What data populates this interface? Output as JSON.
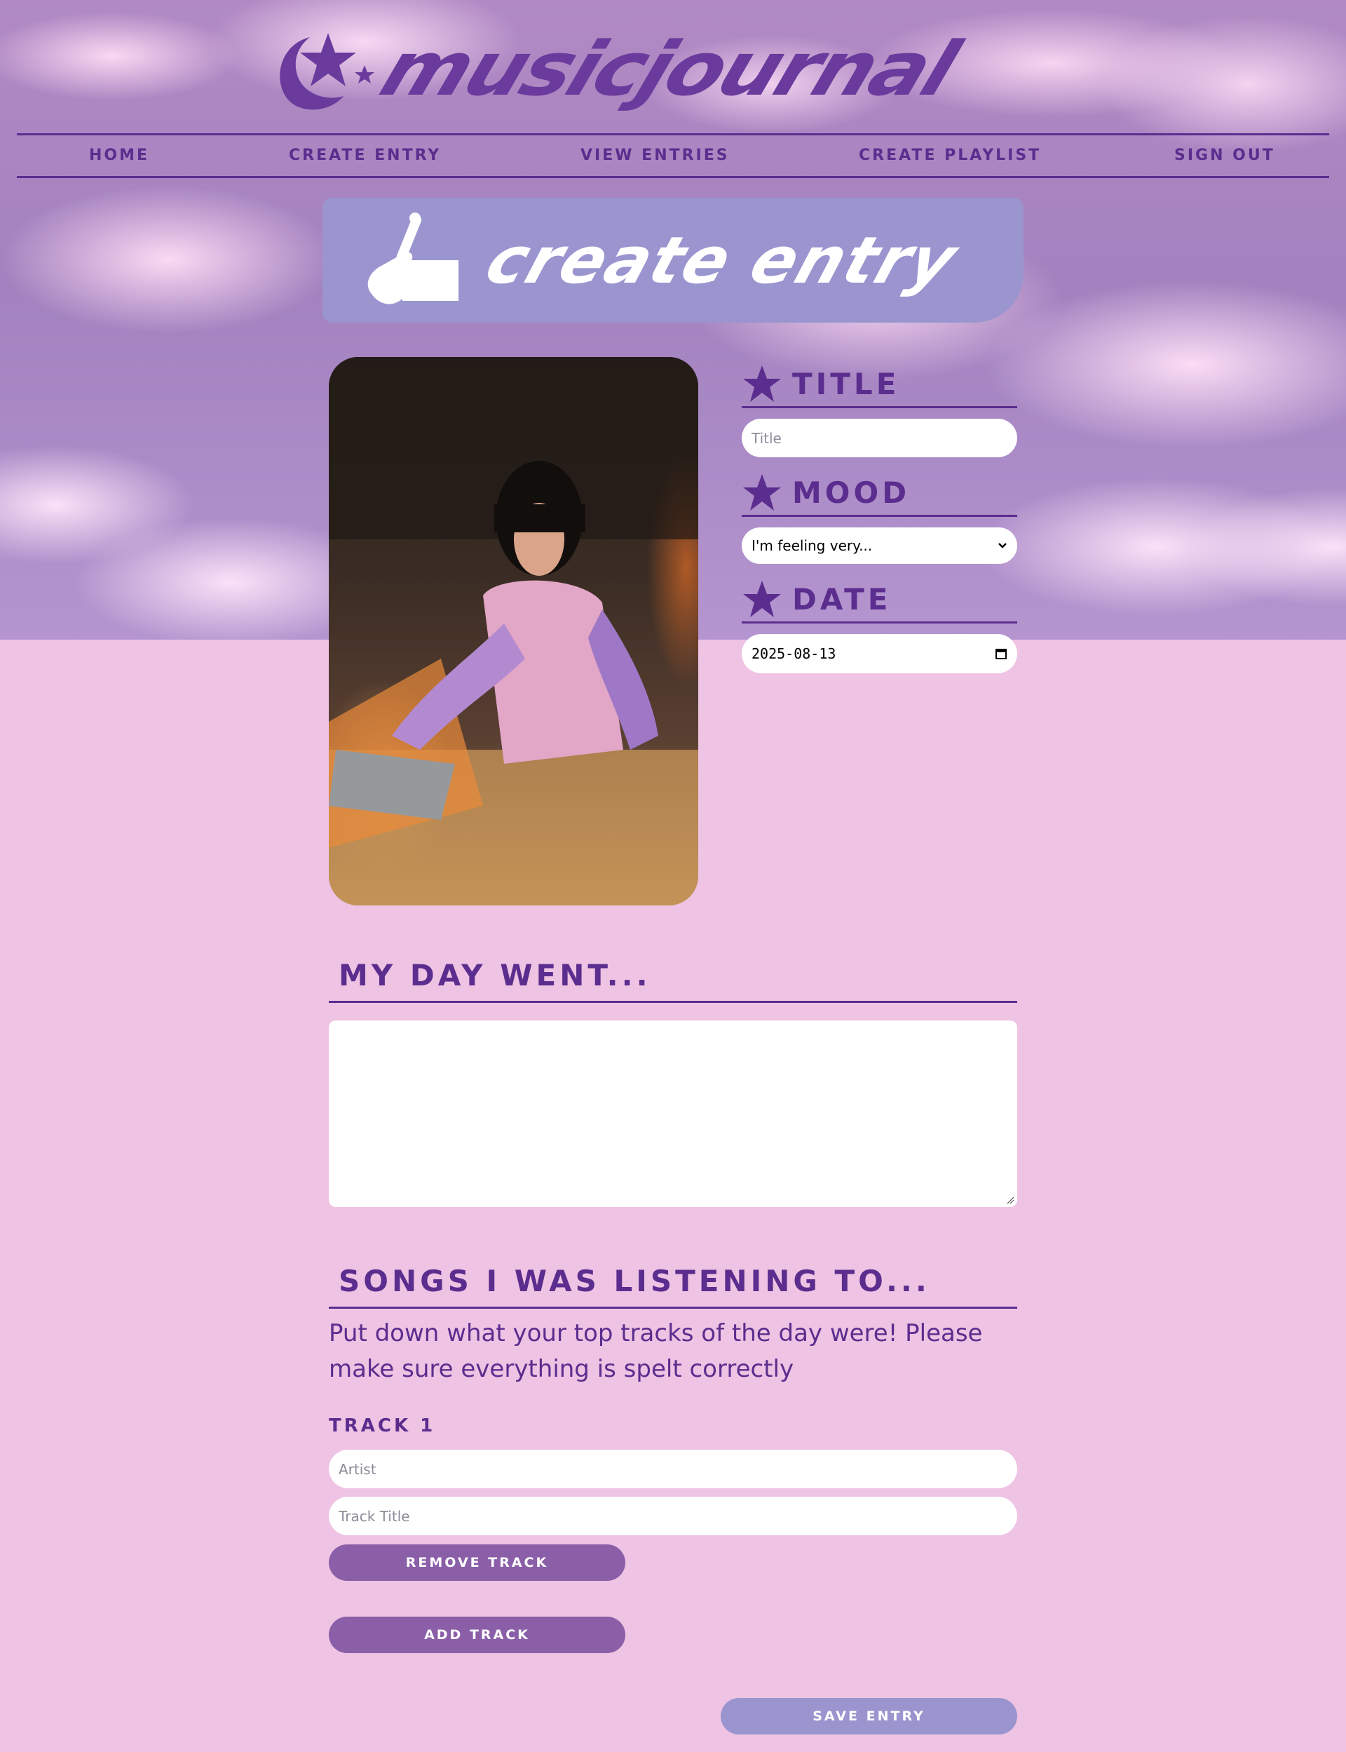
{
  "app": {
    "logo_text": "musicjournal"
  },
  "nav": {
    "items": [
      {
        "label": "Home"
      },
      {
        "label": "Create Entry"
      },
      {
        "label": "View Entries"
      },
      {
        "label": "Create Playlist"
      },
      {
        "label": "Sign Out"
      }
    ]
  },
  "banner": {
    "title": "create entry",
    "icon": "hand-writing-icon"
  },
  "form": {
    "title": {
      "label": "Title",
      "placeholder": "Title",
      "value": ""
    },
    "mood": {
      "label": "Mood",
      "selected": "I'm feeling very..."
    },
    "date": {
      "label": "Date",
      "value": "2025-08-13"
    },
    "day": {
      "label": "My day went...",
      "value": ""
    },
    "songs": {
      "label": "Songs I was listening to...",
      "note": "Put down what your top tracks of the day were! Please make sure everything is spelt correctly",
      "tracks": [
        {
          "label": "Track 1",
          "artist_placeholder": "Artist",
          "title_placeholder": "Track Title",
          "remove_label": "Remove Track"
        }
      ],
      "add_label": "Add Track"
    },
    "save_label": "Save Entry"
  },
  "colors": {
    "primary": "#5b2d8e",
    "button": "#8a5fa8",
    "banner": "#9a95cf",
    "background": "#eec3e3"
  }
}
